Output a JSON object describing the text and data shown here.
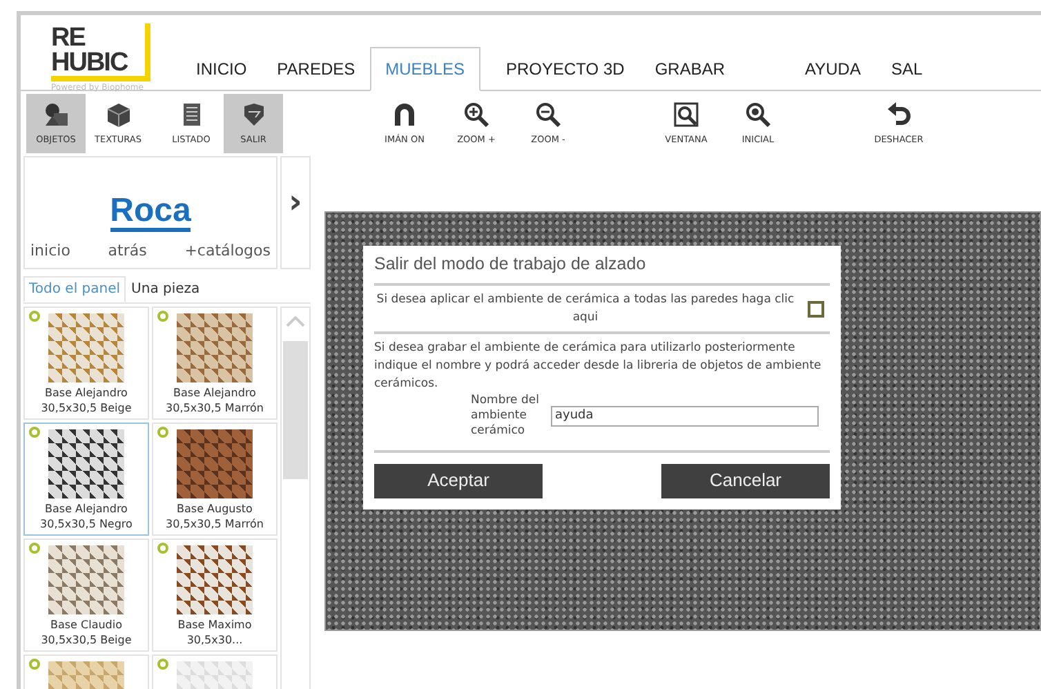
{
  "logo": {
    "line1": "RE",
    "line2": "HUBIC",
    "tagline": "Powered by Biophome"
  },
  "tabs": [
    {
      "label": "INICIO",
      "selected": false
    },
    {
      "label": "PAREDES",
      "selected": false
    },
    {
      "label": "MUEBLES",
      "selected": true
    },
    {
      "label": "PROYECTO 3D",
      "selected": false
    },
    {
      "label": "GRABAR",
      "selected": false
    },
    {
      "label": "AYUDA",
      "selected": false
    },
    {
      "label": "SAL",
      "selected": false
    }
  ],
  "mode_tools": [
    {
      "label": "OBJETOS",
      "selected": true
    },
    {
      "label": "TEXTURAS",
      "selected": false
    },
    {
      "label": "LISTADO",
      "selected": false
    },
    {
      "label": "SALIR",
      "selected": true
    }
  ],
  "tools": [
    "IMÁN ON",
    "ZOOM +",
    "ZOOM -",
    "VENTANA",
    "INICIAL",
    "DESHACER"
  ],
  "catalog": {
    "brand": "Roca",
    "links": [
      "inicio",
      "atrás",
      "+catálogos"
    ],
    "next": "›"
  },
  "panel_tabs": [
    {
      "label": "Todo el panel",
      "selected": true
    },
    {
      "label": "Una pieza",
      "selected": false
    }
  ],
  "tiles": [
    {
      "name": "Base Alejandro 30,5x30,5 Beige",
      "selected": false
    },
    {
      "name": "Base Alejandro 30,5x30,5 Marrón",
      "selected": false
    },
    {
      "name": "Base Alejandro 30,5x30,5 Negro",
      "selected": true
    },
    {
      "name": "Base Augusto 30,5x30,5 Marrón",
      "selected": false
    },
    {
      "name": "Base Claudio 30,5x30,5 Beige",
      "selected": false
    },
    {
      "name": "Base Maximo 30,5x30...",
      "selected": false
    },
    {
      "selected": false
    },
    {
      "selected": false
    }
  ],
  "dialog": {
    "title": "Salir del modo de trabajo de alzado",
    "apply_text": "Si desea aplicar el ambiente de cerámica a todas las paredes haga clic aqui",
    "apply_checked": false,
    "save_text": "Si desea grabar el ambiente de cerámica para utilizarlo posteriormente indique el nombre y podrá acceder desde la libreria de objetos de ambiente cerámicos.",
    "name_label": "Nombre del ambiente cerámico",
    "name_value": "ayuda",
    "buttons": [
      "Aceptar",
      "Cancelar"
    ]
  }
}
